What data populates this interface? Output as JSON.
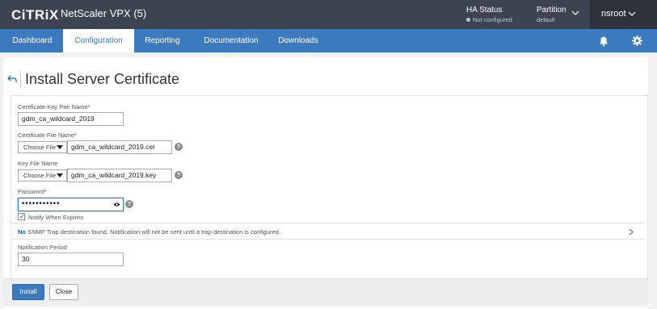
{
  "header": {
    "logo": "CiTRiX",
    "product": "NetScaler VPX (5)",
    "ha_status": {
      "label": "HA Status",
      "value": "Not configured"
    },
    "partition": {
      "label": "Partition",
      "value": "default"
    },
    "user": "nsroot"
  },
  "nav": {
    "tabs": [
      {
        "label": "Dashboard"
      },
      {
        "label": "Configuration"
      },
      {
        "label": "Reporting"
      },
      {
        "label": "Documentation"
      },
      {
        "label": "Downloads"
      }
    ],
    "active_tab": "Configuration"
  },
  "page": {
    "title": "Install Server Certificate"
  },
  "form": {
    "cert_key_pair": {
      "label": "Certificate-Key Pair Name*",
      "value": "gdm_ca_wildcard_2019"
    },
    "cert_file": {
      "label": "Certificate File Name*",
      "choose": "Choose File",
      "value": "gdm_ca_wildcard_2019.cer"
    },
    "key_file": {
      "label": "Key File Name",
      "choose": "Choose File",
      "value": "gdm_ca_wildcard_2019.key"
    },
    "password": {
      "label": "Password*",
      "masked": "•••••••••••"
    },
    "notify": {
      "label": "Notify When Expires",
      "checked": true
    },
    "snmp": {
      "no": "No",
      "message": "SNMP Trap destination found. Notification will not be sent until a trap destination is configured."
    },
    "notification_period": {
      "label": "Notification Period",
      "value": "30"
    },
    "help": "?"
  },
  "buttons": {
    "install": "Install",
    "close": "Close"
  },
  "colors": {
    "topbar": "#3d4350",
    "nav": "#3c7ac0",
    "accent": "#1b5fa8"
  }
}
